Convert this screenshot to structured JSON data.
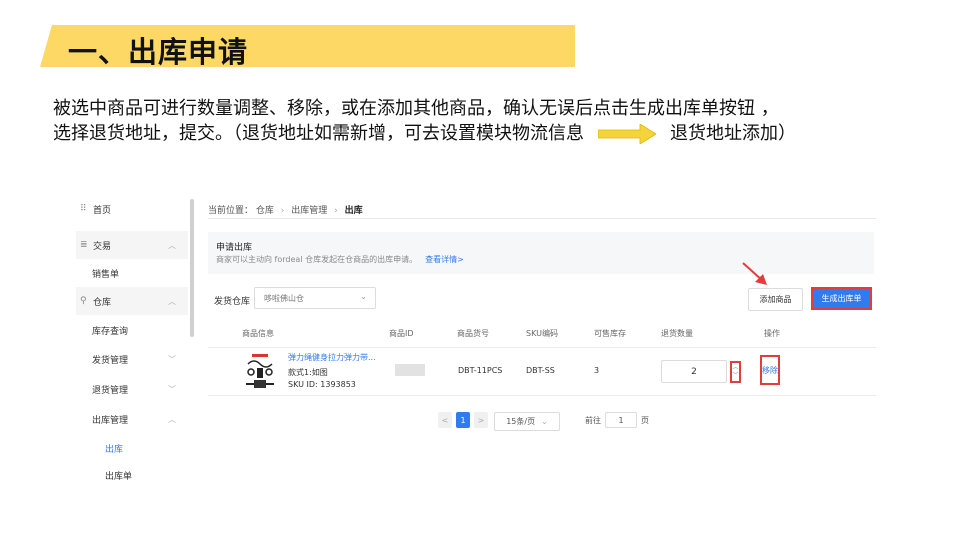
{
  "slide": {
    "title": "一、出库申请",
    "desc_line1": "被选中商品可进行数量调整、移除，或在添加其他商品，确认无误后点击生成出库单按钮 ，",
    "desc_line2a": "选择退货地址，提交。（退货地址如需新增，可去设置模块物流信息",
    "desc_line2b": "退货地址添加）",
    "arrow_color": "#f5d33a"
  },
  "sidebar": {
    "items": [
      {
        "label": "首页",
        "icon": "grid-icon"
      },
      {
        "label": "交易",
        "icon": "list-icon",
        "chevron": "︿"
      },
      {
        "label": "销售单"
      },
      {
        "label": "仓库",
        "icon": "box-icon",
        "chevron": "︿"
      },
      {
        "label": "库存查询"
      },
      {
        "label": "发货管理",
        "chevron": "﹀"
      },
      {
        "label": "退货管理",
        "chevron": "﹀"
      },
      {
        "label": "出库管理",
        "chevron": "︿"
      },
      {
        "label": "出库"
      },
      {
        "label": "出库单"
      }
    ]
  },
  "breadcrumb": {
    "prefix": "当前位置：",
    "items": [
      "仓库",
      "出库管理",
      "出库"
    ]
  },
  "apply": {
    "heading": "申请出库",
    "subtitle": "商家可以主动向 fordeal 仓库发起在仓商品的出库申请。",
    "link": "查看详情>"
  },
  "warehouse": {
    "label": "发货仓库",
    "value": "哆啦佛山仓"
  },
  "buttons": {
    "add": "添加商品",
    "generate": "生成出库单"
  },
  "table": {
    "headers": [
      "商品信息",
      "商品ID",
      "商品货号",
      "SKU编码",
      "可售库存",
      "退货数量",
      "操作"
    ],
    "row": {
      "name": "弹力绳健身拉力弹力带...",
      "spec": "款式1:如图",
      "sku_id": "SKU ID: 1393853",
      "item_no": "DBT-11PCS",
      "sku_code": "DBT-SS",
      "stock": "3",
      "qty": "2",
      "action": "移除"
    }
  },
  "pager": {
    "prev": "<",
    "page": "1",
    "next": ">",
    "page_size": "15条/页",
    "goto_label": "前往",
    "goto_value": "1",
    "page_label": "页"
  },
  "colors": {
    "accent": "#2f7bf0",
    "highlight": "#e23d3d",
    "title_band": "#fdd865"
  }
}
